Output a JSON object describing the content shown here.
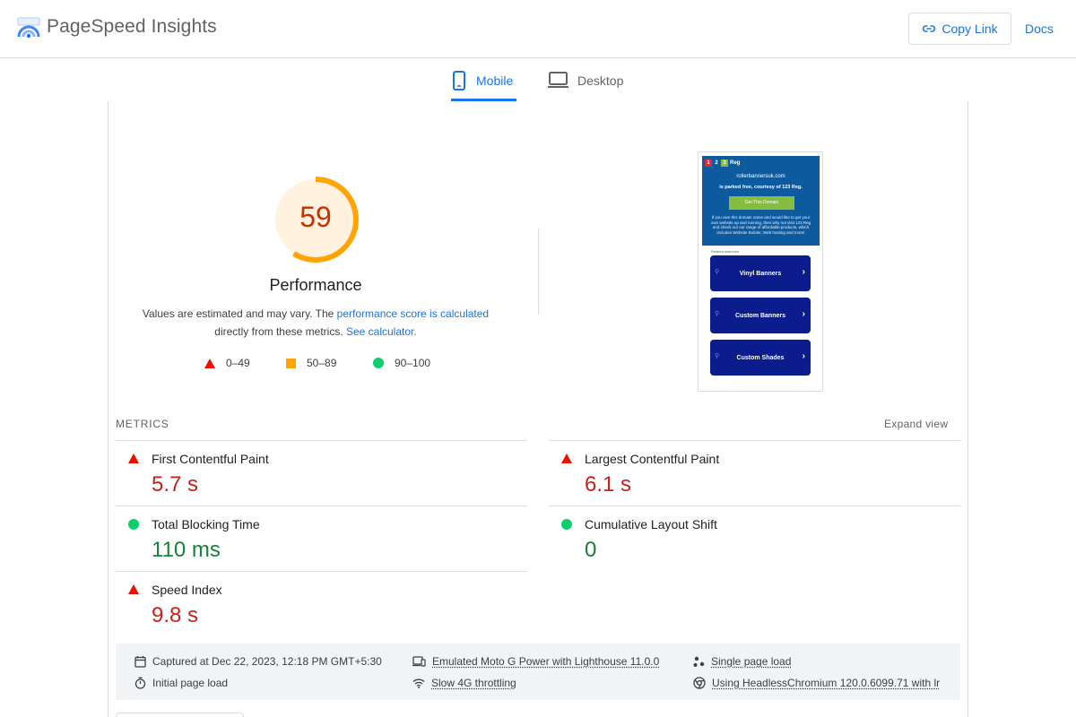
{
  "header": {
    "title": "PageSpeed Insights",
    "copy_link": "Copy Link",
    "docs": "Docs"
  },
  "tabs": [
    {
      "label": "Mobile",
      "active": true
    },
    {
      "label": "Desktop",
      "active": false
    }
  ],
  "score": {
    "value": "59",
    "fraction": 0.59,
    "category": "Performance",
    "desc_part1": "Values are estimated and may vary. The ",
    "desc_link1": "performance score is calculated",
    "desc_part2": " directly from these metrics. ",
    "desc_link2": "See calculator.",
    "color": "#ffa400"
  },
  "legend": [
    {
      "label": "0–49",
      "shape": "triangle",
      "color": "#eb0f00"
    },
    {
      "label": "50–89",
      "shape": "square",
      "color": "#ffa400"
    },
    {
      "label": "90–100",
      "shape": "circle",
      "color": "#0cce6b"
    }
  ],
  "screenshot": {
    "brand_digits": [
      "1",
      "2",
      "3"
    ],
    "brand_name": "Reg",
    "domain": "rollerbannersuk.com",
    "parked": "is parked free, courtesy of 123 Reg.",
    "button": "Get This Domain",
    "text": "If you own this domain name and would like to get your own website up and running, then why not visit 123 Reg and check out our range of affordable products, which includes Website Builder, Web hosting and more!",
    "related": "Related searches",
    "cards": [
      "Vinyl Banners",
      "Custom Banners",
      "Custom Shades"
    ]
  },
  "metrics": {
    "title": "METRICS",
    "expand": "Expand view",
    "items": [
      {
        "name": "First Contentful Paint",
        "value": "5.7 s",
        "status": "bad"
      },
      {
        "name": "Largest Contentful Paint",
        "value": "6.1 s",
        "status": "bad"
      },
      {
        "name": "Total Blocking Time",
        "value": "110 ms",
        "status": "good"
      },
      {
        "name": "Cumulative Layout Shift",
        "value": "0",
        "status": "good"
      },
      {
        "name": "Speed Index",
        "value": "9.8 s",
        "status": "bad"
      }
    ]
  },
  "info": {
    "captured": "Captured at Dec 22, 2023, 12:18 PM GMT+5:30",
    "emulated": "Emulated Moto G Power with Lighthouse 11.0.0",
    "single": "Single page load",
    "initial": "Initial page load",
    "throttling": "Slow 4G throttling",
    "browser": "Using HeadlessChromium 120.0.6099.71 with lr"
  }
}
